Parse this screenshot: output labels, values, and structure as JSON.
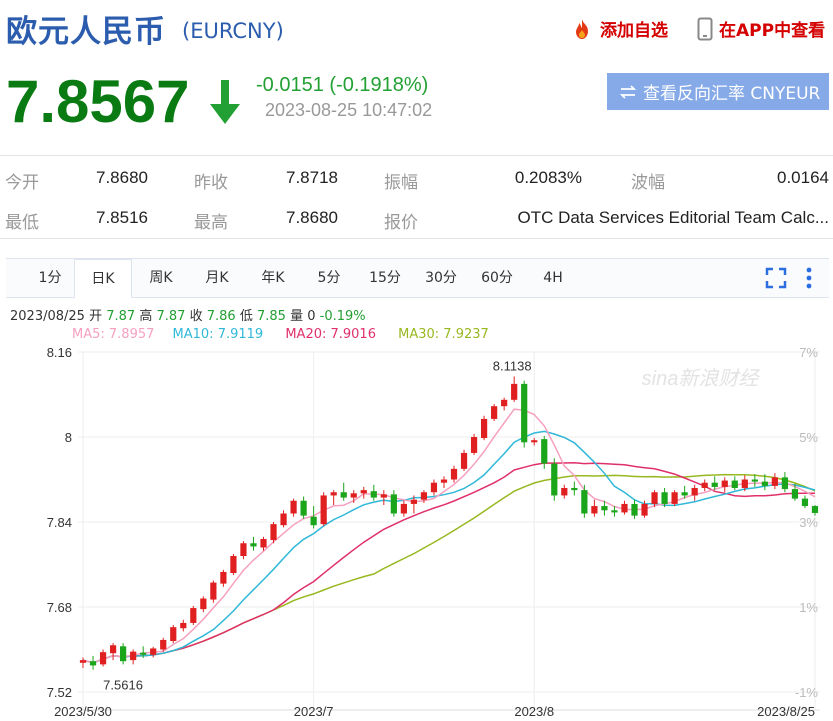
{
  "header": {
    "title": "欧元人民币",
    "code": "(EURCNY)",
    "add_favorite": "添加自选",
    "view_in_app": "在APP中查看"
  },
  "quote": {
    "price": "7.8567",
    "change": "-0.0151 (-0.1918%)",
    "time": "2023-08-25 10:47:02",
    "reverse_label": "查看反向汇率 CNYEUR",
    "direction": "down"
  },
  "stats": {
    "open_label": "今开",
    "open": "7.8680",
    "prev_close_label": "昨收",
    "prev_close": "7.8718",
    "amplitude_label": "振幅",
    "amplitude": "0.2083%",
    "wave_label": "波幅",
    "wave": "0.0164",
    "low_label": "最低",
    "low": "7.8516",
    "high_label": "最高",
    "high": "7.8680",
    "quote_label": "报价",
    "quote_source": "OTC Data Services Editorial Team Calc..."
  },
  "tabs": [
    {
      "label": "1分"
    },
    {
      "label": "日K"
    },
    {
      "label": "周K"
    },
    {
      "label": "月K"
    },
    {
      "label": "年K"
    },
    {
      "label": "5分"
    },
    {
      "label": "15分"
    },
    {
      "label": "30分"
    },
    {
      "label": "60分"
    },
    {
      "label": "4H"
    }
  ],
  "active_tab": "日K",
  "info": {
    "date": "2023/08/25",
    "open_label": "开",
    "open": "7.87",
    "high_label": "高",
    "high": "7.87",
    "close_label": "收",
    "close": "7.86",
    "low_label": "低",
    "low": "7.85",
    "vol_label": "量",
    "vol": "0",
    "pct": "-0.19%"
  },
  "ma": {
    "ma5": "MA5: 7.8957",
    "ma10": "MA10: 7.9119",
    "ma20": "MA20: 7.9016",
    "ma30": "MA30: 7.9237"
  },
  "colors": {
    "up": "#e02020",
    "down": "#1aa51a",
    "ma5": "#f5a0c0",
    "ma10": "#30b8d8",
    "ma20": "#e0306a",
    "ma30": "#98b820",
    "title": "#2b5cae",
    "price_down": "#0a7a12"
  },
  "chart_data": {
    "type": "candlestick",
    "y_ticks": [
      "8.16",
      "8",
      "7.84",
      "7.68",
      "7.52"
    ],
    "y_ticks_pct": [
      "7%",
      "5%",
      "3%",
      "1%",
      "-1%"
    ],
    "x_ticks": [
      "2023/5/30",
      "2023/7",
      "2023/8",
      "2023/8/25"
    ],
    "max_label": "8.1138",
    "min_label": "7.5616",
    "ylim": [
      7.52,
      8.16
    ],
    "watermark": "sina新浪财经",
    "candles": [
      [
        7.575,
        7.585,
        7.565,
        7.58
      ],
      [
        7.578,
        7.588,
        7.562,
        7.57
      ],
      [
        7.572,
        7.6,
        7.568,
        7.595
      ],
      [
        7.593,
        7.612,
        7.58,
        7.608
      ],
      [
        7.606,
        7.612,
        7.572,
        7.578
      ],
      [
        7.58,
        7.6,
        7.572,
        7.596
      ],
      [
        7.594,
        7.606,
        7.584,
        7.59
      ],
      [
        7.59,
        7.605,
        7.585,
        7.602
      ],
      [
        7.6,
        7.622,
        7.596,
        7.618
      ],
      [
        7.616,
        7.646,
        7.612,
        7.642
      ],
      [
        7.64,
        7.656,
        7.634,
        7.65
      ],
      [
        7.65,
        7.682,
        7.646,
        7.678
      ],
      [
        7.676,
        7.7,
        7.67,
        7.696
      ],
      [
        7.694,
        7.73,
        7.688,
        7.726
      ],
      [
        7.724,
        7.75,
        7.718,
        7.746
      ],
      [
        7.744,
        7.78,
        7.74,
        7.776
      ],
      [
        7.776,
        7.804,
        7.77,
        7.8
      ],
      [
        7.8,
        7.812,
        7.786,
        7.794
      ],
      [
        7.792,
        7.812,
        7.786,
        7.808
      ],
      [
        7.806,
        7.84,
        7.8,
        7.836
      ],
      [
        7.834,
        7.862,
        7.83,
        7.856
      ],
      [
        7.856,
        7.884,
        7.85,
        7.88
      ],
      [
        7.88,
        7.888,
        7.846,
        7.852
      ],
      [
        7.85,
        7.87,
        7.828,
        7.834
      ],
      [
        7.836,
        7.896,
        7.832,
        7.89
      ],
      [
        7.89,
        7.9,
        7.872,
        7.896
      ],
      [
        7.896,
        7.914,
        7.88,
        7.886
      ],
      [
        7.886,
        7.9,
        7.876,
        7.894
      ],
      [
        7.894,
        7.906,
        7.884,
        7.9
      ],
      [
        7.898,
        7.91,
        7.88,
        7.886
      ],
      [
        7.886,
        7.9,
        7.872,
        7.892
      ],
      [
        7.892,
        7.9,
        7.85,
        7.856
      ],
      [
        7.856,
        7.88,
        7.85,
        7.874
      ],
      [
        7.874,
        7.89,
        7.856,
        7.882
      ],
      [
        7.882,
        7.9,
        7.876,
        7.896
      ],
      [
        7.896,
        7.92,
        7.89,
        7.914
      ],
      [
        7.914,
        7.926,
        7.904,
        7.92
      ],
      [
        7.92,
        7.946,
        7.914,
        7.94
      ],
      [
        7.94,
        7.976,
        7.936,
        7.97
      ],
      [
        7.97,
        8.006,
        7.966,
        8.0
      ],
      [
        7.998,
        8.04,
        7.994,
        8.034
      ],
      [
        8.034,
        8.062,
        8.03,
        8.058
      ],
      [
        8.058,
        8.074,
        8.05,
        8.07
      ],
      [
        8.07,
        8.114,
        8.066,
        8.1
      ],
      [
        8.1,
        8.106,
        7.98,
        7.99
      ],
      [
        7.99,
        7.998,
        7.984,
        7.994
      ],
      [
        7.996,
        8.002,
        7.94,
        7.95
      ],
      [
        7.95,
        7.96,
        7.88,
        7.89
      ],
      [
        7.89,
        7.91,
        7.884,
        7.904
      ],
      [
        7.904,
        7.916,
        7.89,
        7.9
      ],
      [
        7.9,
        7.91,
        7.848,
        7.856
      ],
      [
        7.856,
        7.882,
        7.85,
        7.87
      ],
      [
        7.87,
        7.88,
        7.852,
        7.862
      ],
      [
        7.862,
        7.87,
        7.85,
        7.858
      ],
      [
        7.858,
        7.88,
        7.854,
        7.874
      ],
      [
        7.874,
        7.882,
        7.846,
        7.852
      ],
      [
        7.852,
        7.88,
        7.848,
        7.874
      ],
      [
        7.874,
        7.9,
        7.868,
        7.896
      ],
      [
        7.896,
        7.904,
        7.868,
        7.874
      ],
      [
        7.874,
        7.9,
        7.87,
        7.896
      ],
      [
        7.896,
        7.908,
        7.884,
        7.89
      ],
      [
        7.89,
        7.91,
        7.88,
        7.904
      ],
      [
        7.904,
        7.92,
        7.898,
        7.914
      ],
      [
        7.914,
        7.926,
        7.9,
        7.906
      ],
      [
        7.906,
        7.924,
        7.896,
        7.918
      ],
      [
        7.918,
        7.926,
        7.9,
        7.904
      ],
      [
        7.904,
        7.928,
        7.898,
        7.92
      ],
      [
        7.92,
        7.93,
        7.906,
        7.916
      ],
      [
        7.916,
        7.93,
        7.9,
        7.908
      ],
      [
        7.908,
        7.932,
        7.902,
        7.924
      ],
      [
        7.924,
        7.934,
        7.896,
        7.902
      ],
      [
        7.902,
        7.912,
        7.88,
        7.884
      ],
      [
        7.884,
        7.89,
        7.866,
        7.87
      ],
      [
        7.87,
        7.872,
        7.852,
        7.857
      ]
    ]
  }
}
